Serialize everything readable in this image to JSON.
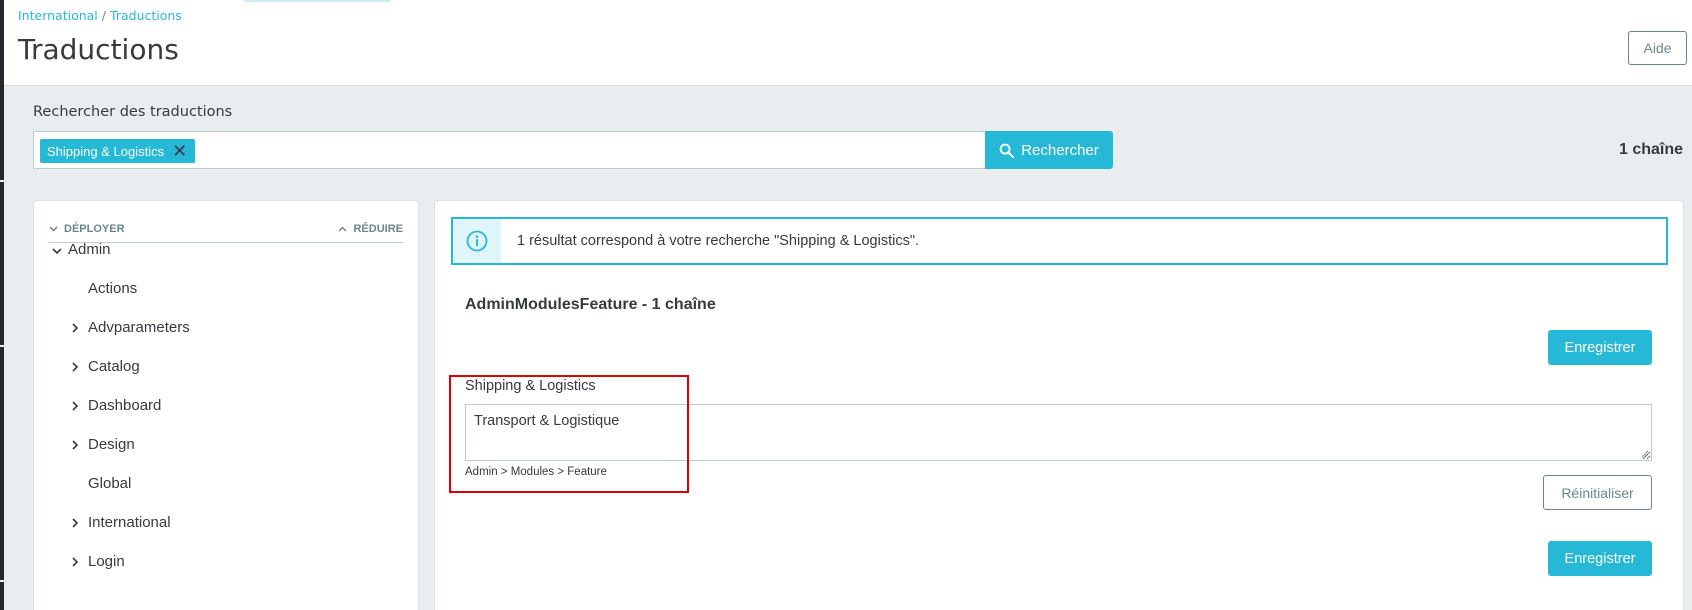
{
  "breadcrumb": {
    "parent": "International",
    "current": "Traductions"
  },
  "page": {
    "title": "Traductions",
    "help_label": "Aide"
  },
  "search": {
    "label": "Rechercher des traductions",
    "tag": "Shipping & Logistics",
    "button_label": "Rechercher",
    "result_count": "1 chaîne"
  },
  "tree": {
    "expand_label": "DÉPLOYER",
    "collapse_label": "RÉDUIRE",
    "root": "Admin",
    "items": [
      {
        "label": "Actions",
        "has_children": false
      },
      {
        "label": "Advparameters",
        "has_children": true
      },
      {
        "label": "Catalog",
        "has_children": true
      },
      {
        "label": "Dashboard",
        "has_children": true
      },
      {
        "label": "Design",
        "has_children": true
      },
      {
        "label": "Global",
        "has_children": false
      },
      {
        "label": "International",
        "has_children": true
      },
      {
        "label": "Login",
        "has_children": true
      }
    ]
  },
  "main": {
    "alert_text": "1 résultat correspond à votre recherche \"Shipping & Logistics\".",
    "domain_title": "AdminModulesFeature - 1 chaîne",
    "save_label": "Enregistrer",
    "reset_label": "Réinitialiser",
    "original": "Shipping & Logistics",
    "translation": "Transport & Logistique",
    "domain_path": "Admin > Modules > Feature"
  },
  "colors": {
    "accent": "#25b9d7",
    "highlight": "#e00000",
    "text": "#363a41",
    "muted": "#6c868e"
  }
}
